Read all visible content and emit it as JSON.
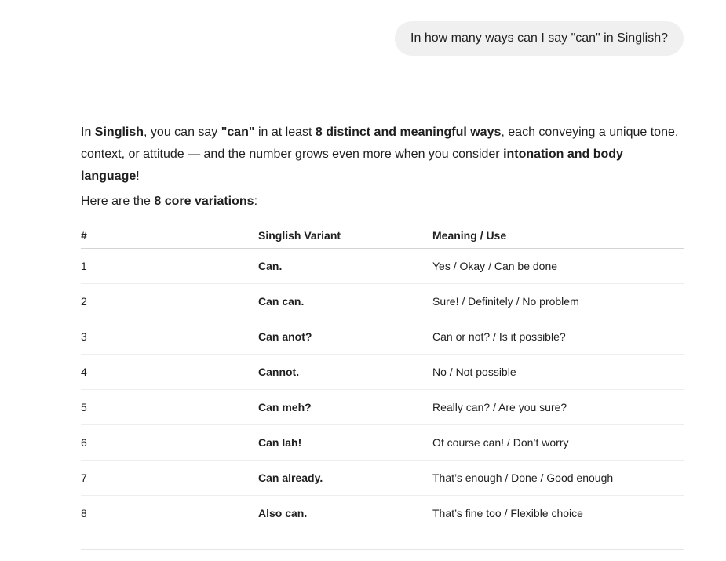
{
  "user_message": "In how many ways can I say \"can\" in Singlish?",
  "intro": {
    "t1": "In ",
    "b1": "Singlish",
    "t2": ", you can say ",
    "b2": "\"can\"",
    "t3": " in at least ",
    "b3": "8 distinct and meaningful ways",
    "t4": ", each conveying a unique tone, context, or attitude — and the number grows even more when you consider ",
    "b4": "intonation and body language",
    "t5": "!"
  },
  "lead": {
    "t1": "Here are the ",
    "b1": "8 core variations",
    "t2": ":"
  },
  "table": {
    "headers": [
      "#",
      "Singlish Variant",
      "Meaning / Use"
    ],
    "rows": [
      {
        "num": "1",
        "variant": "Can.",
        "meaning": "Yes / Okay / Can be done"
      },
      {
        "num": "2",
        "variant": "Can can.",
        "meaning": "Sure! / Definitely / No problem"
      },
      {
        "num": "3",
        "variant": "Can anot?",
        "meaning": "Can or not? / Is it possible?"
      },
      {
        "num": "4",
        "variant": "Cannot.",
        "meaning": "No / Not possible"
      },
      {
        "num": "5",
        "variant": "Can meh?",
        "meaning": "Really can? / Are you sure?"
      },
      {
        "num": "6",
        "variant": "Can lah!",
        "meaning": "Of course can! / Don’t worry"
      },
      {
        "num": "7",
        "variant": "Can already.",
        "meaning": "That’s enough / Done / Good enough"
      },
      {
        "num": "8",
        "variant": "Also can.",
        "meaning": "That’s fine too / Flexible choice"
      }
    ]
  },
  "colors": {
    "text": "#1f1f1f",
    "bubble_bg": "#f0f0f0",
    "header_rule": "#d4d4d4",
    "row_rule": "#eeeeee"
  }
}
